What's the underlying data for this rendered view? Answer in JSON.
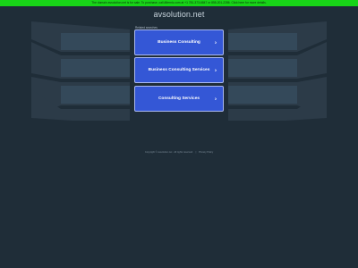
{
  "banner": {
    "text": "The domain avsolution.net is for sale. To purchase, call Afternic.com at +1 781-373-6847 or 855-201-2286. Click here for more details."
  },
  "domain": "avsolution.net",
  "related_label": "Related searches",
  "links": [
    {
      "label": "Business Consulting",
      "icon": "chevron-right-icon"
    },
    {
      "label": "Business Consulting Services",
      "icon": "chevron-right-icon"
    },
    {
      "label": "Consulting Services",
      "icon": "chevron-right-icon"
    }
  ],
  "footer": {
    "copyright": "Copyright © avsolution.net . All rights reserved.",
    "separator": "|",
    "privacy": "Privacy Policy"
  },
  "colors": {
    "background": "#1f2d38",
    "banner": "#18d418",
    "link_button": "#3457d6"
  }
}
